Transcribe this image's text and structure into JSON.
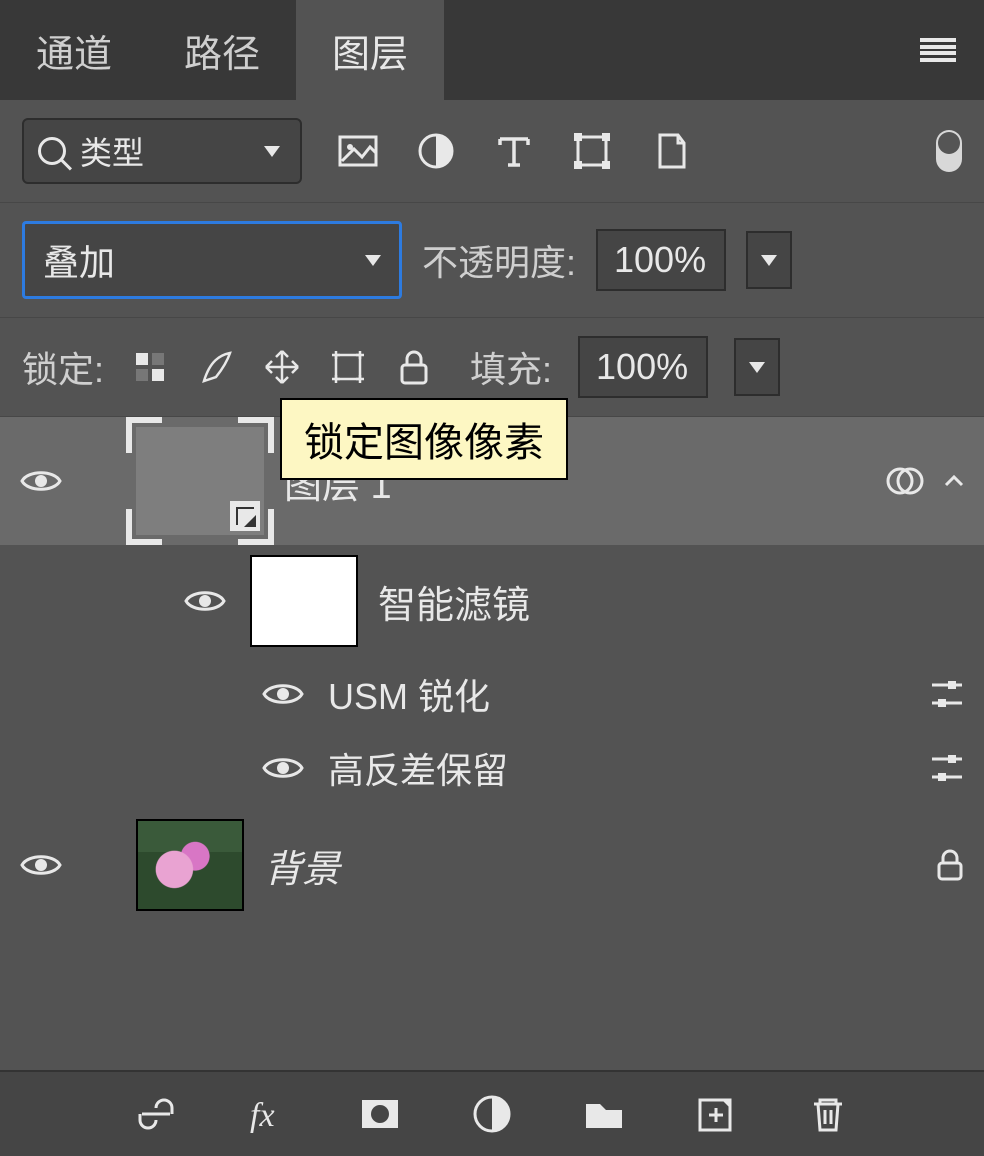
{
  "tabs": [
    "通道",
    "路径",
    "图层"
  ],
  "activeTab": 2,
  "filterDropdown": "类型",
  "blendMode": "叠加",
  "opacityLabel": "不透明度:",
  "opacityValue": "100%",
  "lockLabel": "锁定:",
  "fillLabel": "填充:",
  "fillValue": "100%",
  "tooltip": "锁定图像像素",
  "layers": [
    {
      "name": "图层 1",
      "smartFiltersLabel": "智能滤镜",
      "filters": [
        "USM 锐化",
        "高反差保留"
      ]
    },
    {
      "name": "背景"
    }
  ]
}
